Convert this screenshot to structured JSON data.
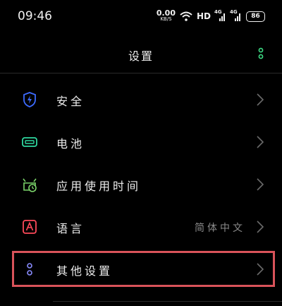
{
  "status": {
    "time": "09:46",
    "net_speed_value": "0.00",
    "net_speed_unit": "KB/S",
    "hd_label": "HD",
    "signal1_tag": "4G",
    "signal2_tag": "4G",
    "battery_level": "86"
  },
  "header": {
    "title": "设置"
  },
  "menu": {
    "items": [
      {
        "label": "安全",
        "value": "",
        "icon": "shield-lightning-icon"
      },
      {
        "label": "电池",
        "value": "",
        "icon": "battery-icon"
      },
      {
        "label": "应用使用时间",
        "value": "",
        "icon": "app-usage-clock-icon"
      },
      {
        "label": "语言",
        "value": "简体中文",
        "icon": "language-a-icon"
      },
      {
        "label": "其他设置",
        "value": "",
        "icon": "more-dots-icon"
      }
    ]
  },
  "colors": {
    "accent_green": "#3ddc84",
    "security_blue": "#3d6bff",
    "battery_green": "#2fd8a0",
    "usage_green": "#7bd46a",
    "language_red": "#ff4a5a",
    "more_purple": "#8a8cff",
    "highlight_red": "#d9535a"
  }
}
